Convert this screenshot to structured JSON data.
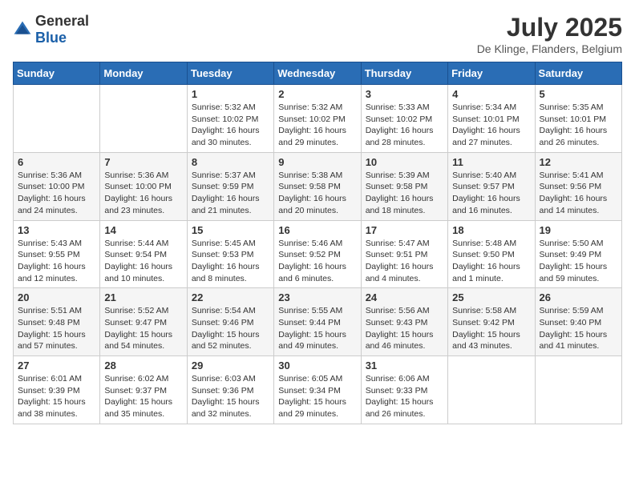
{
  "header": {
    "logo_general": "General",
    "logo_blue": "Blue",
    "month": "July 2025",
    "location": "De Klinge, Flanders, Belgium"
  },
  "days_of_week": [
    "Sunday",
    "Monday",
    "Tuesday",
    "Wednesday",
    "Thursday",
    "Friday",
    "Saturday"
  ],
  "weeks": [
    [
      {
        "day": "",
        "info": ""
      },
      {
        "day": "",
        "info": ""
      },
      {
        "day": "1",
        "info": "Sunrise: 5:32 AM\nSunset: 10:02 PM\nDaylight: 16 hours and 30 minutes."
      },
      {
        "day": "2",
        "info": "Sunrise: 5:32 AM\nSunset: 10:02 PM\nDaylight: 16 hours and 29 minutes."
      },
      {
        "day": "3",
        "info": "Sunrise: 5:33 AM\nSunset: 10:02 PM\nDaylight: 16 hours and 28 minutes."
      },
      {
        "day": "4",
        "info": "Sunrise: 5:34 AM\nSunset: 10:01 PM\nDaylight: 16 hours and 27 minutes."
      },
      {
        "day": "5",
        "info": "Sunrise: 5:35 AM\nSunset: 10:01 PM\nDaylight: 16 hours and 26 minutes."
      }
    ],
    [
      {
        "day": "6",
        "info": "Sunrise: 5:36 AM\nSunset: 10:00 PM\nDaylight: 16 hours and 24 minutes."
      },
      {
        "day": "7",
        "info": "Sunrise: 5:36 AM\nSunset: 10:00 PM\nDaylight: 16 hours and 23 minutes."
      },
      {
        "day": "8",
        "info": "Sunrise: 5:37 AM\nSunset: 9:59 PM\nDaylight: 16 hours and 21 minutes."
      },
      {
        "day": "9",
        "info": "Sunrise: 5:38 AM\nSunset: 9:58 PM\nDaylight: 16 hours and 20 minutes."
      },
      {
        "day": "10",
        "info": "Sunrise: 5:39 AM\nSunset: 9:58 PM\nDaylight: 16 hours and 18 minutes."
      },
      {
        "day": "11",
        "info": "Sunrise: 5:40 AM\nSunset: 9:57 PM\nDaylight: 16 hours and 16 minutes."
      },
      {
        "day": "12",
        "info": "Sunrise: 5:41 AM\nSunset: 9:56 PM\nDaylight: 16 hours and 14 minutes."
      }
    ],
    [
      {
        "day": "13",
        "info": "Sunrise: 5:43 AM\nSunset: 9:55 PM\nDaylight: 16 hours and 12 minutes."
      },
      {
        "day": "14",
        "info": "Sunrise: 5:44 AM\nSunset: 9:54 PM\nDaylight: 16 hours and 10 minutes."
      },
      {
        "day": "15",
        "info": "Sunrise: 5:45 AM\nSunset: 9:53 PM\nDaylight: 16 hours and 8 minutes."
      },
      {
        "day": "16",
        "info": "Sunrise: 5:46 AM\nSunset: 9:52 PM\nDaylight: 16 hours and 6 minutes."
      },
      {
        "day": "17",
        "info": "Sunrise: 5:47 AM\nSunset: 9:51 PM\nDaylight: 16 hours and 4 minutes."
      },
      {
        "day": "18",
        "info": "Sunrise: 5:48 AM\nSunset: 9:50 PM\nDaylight: 16 hours and 1 minute."
      },
      {
        "day": "19",
        "info": "Sunrise: 5:50 AM\nSunset: 9:49 PM\nDaylight: 15 hours and 59 minutes."
      }
    ],
    [
      {
        "day": "20",
        "info": "Sunrise: 5:51 AM\nSunset: 9:48 PM\nDaylight: 15 hours and 57 minutes."
      },
      {
        "day": "21",
        "info": "Sunrise: 5:52 AM\nSunset: 9:47 PM\nDaylight: 15 hours and 54 minutes."
      },
      {
        "day": "22",
        "info": "Sunrise: 5:54 AM\nSunset: 9:46 PM\nDaylight: 15 hours and 52 minutes."
      },
      {
        "day": "23",
        "info": "Sunrise: 5:55 AM\nSunset: 9:44 PM\nDaylight: 15 hours and 49 minutes."
      },
      {
        "day": "24",
        "info": "Sunrise: 5:56 AM\nSunset: 9:43 PM\nDaylight: 15 hours and 46 minutes."
      },
      {
        "day": "25",
        "info": "Sunrise: 5:58 AM\nSunset: 9:42 PM\nDaylight: 15 hours and 43 minutes."
      },
      {
        "day": "26",
        "info": "Sunrise: 5:59 AM\nSunset: 9:40 PM\nDaylight: 15 hours and 41 minutes."
      }
    ],
    [
      {
        "day": "27",
        "info": "Sunrise: 6:01 AM\nSunset: 9:39 PM\nDaylight: 15 hours and 38 minutes."
      },
      {
        "day": "28",
        "info": "Sunrise: 6:02 AM\nSunset: 9:37 PM\nDaylight: 15 hours and 35 minutes."
      },
      {
        "day": "29",
        "info": "Sunrise: 6:03 AM\nSunset: 9:36 PM\nDaylight: 15 hours and 32 minutes."
      },
      {
        "day": "30",
        "info": "Sunrise: 6:05 AM\nSunset: 9:34 PM\nDaylight: 15 hours and 29 minutes."
      },
      {
        "day": "31",
        "info": "Sunrise: 6:06 AM\nSunset: 9:33 PM\nDaylight: 15 hours and 26 minutes."
      },
      {
        "day": "",
        "info": ""
      },
      {
        "day": "",
        "info": ""
      }
    ]
  ]
}
